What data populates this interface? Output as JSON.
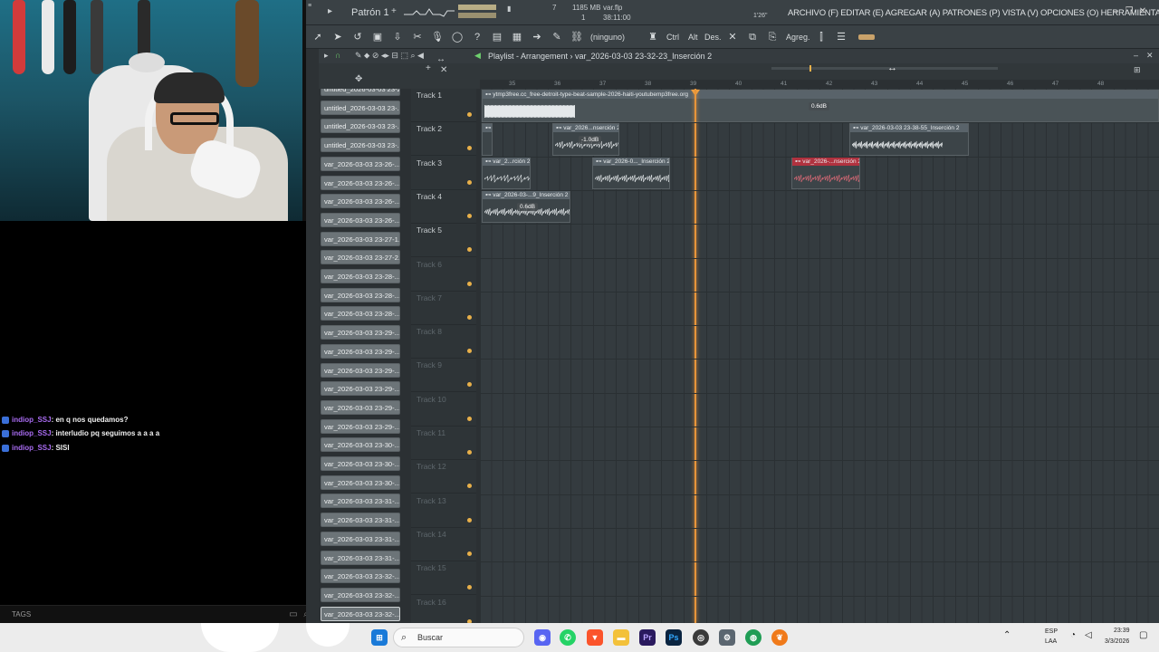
{
  "fl": {
    "pattern_label": "Patrón 1",
    "cpu_num": "7",
    "memory": "1185 MB",
    "mem_num": "1",
    "file_name": "var.flp",
    "time": "38:11:00",
    "zoom_time": "1'26\"",
    "menu": "ARCHIVO (F) EDITAR (E) AGREGAR (A) PATRONES (P) VISTA (V) OPCIONES (O) HERRAMIENTAS (T) AYUDA",
    "toolbar_none": "(ninguno)",
    "toolbar_ctrl": "Ctrl",
    "toolbar_alt": "Alt",
    "toolbar_des": "Des.",
    "toolbar_agreg": "Agreg.",
    "playlist_title": "Playlist - Arrangement",
    "arrangement_name": "var_2026-03-03 23-32-23_Inserción 2",
    "bar_numbers": [
      "35",
      "36",
      "37",
      "38",
      "39",
      "40",
      "41",
      "42",
      "43",
      "44",
      "45",
      "46",
      "47",
      "48"
    ],
    "patterns": [
      "untitled_2026-03-03 23-2",
      "untitled_2026-03-03 23-...",
      "untitled_2026-03-03 23-...",
      "untitled_2026-03-03 23-...",
      "var_2026-03-03 23-26-...",
      "var_2026-03-03 23-26-...",
      "var_2026-03-03 23-26-...",
      "var_2026-03-03 23-26-...",
      "var_2026-03-03 23-27-1...",
      "var_2026-03-03 23-27-2...",
      "var_2026-03-03 23-28-...",
      "var_2026-03-03 23-28-...",
      "var_2026-03-03 23-28-...",
      "var_2026-03-03 23-29-...",
      "var_2026-03-03 23-29-...",
      "var_2026-03-03 23-29-...",
      "var_2026-03-03 23-29-...",
      "var_2026-03-03 23-29-...",
      "var_2026-03-03 23-29-...",
      "var_2026-03-03 23-30-...",
      "var_2026-03-03 23-30-...",
      "var_2026-03-03 23-30-...",
      "var_2026-03-03 23-31-...",
      "var_2026-03-03 23-31-...",
      "var_2026-03-03 23-31-...",
      "var_2026-03-03 23-31-...",
      "var_2026-03-03 23-32-...",
      "var_2026-03-03 23-32-...",
      "var_2026-03-03 23-32-..."
    ],
    "tracks": [
      "Track 1",
      "Track 2",
      "Track 3",
      "Track 4",
      "Track 5",
      "Track 6",
      "Track 7",
      "Track 8",
      "Track 9",
      "Track 10",
      "Track 11",
      "Track 12",
      "Track 13",
      "Track 14",
      "Track 15",
      "Track 16"
    ],
    "clips": {
      "c1": {
        "title": "ytmp3free.cc_free-detroit-type-beat-sample-2026-haiti-youtubemp3free.org",
        "gain": "0.6dB"
      },
      "c2a": {
        "title": ""
      },
      "c2b": {
        "title": "var_2026...nserción 2",
        "gain": "-1.0dB"
      },
      "c2c": {
        "title": "var_2026-03-03 23-38-55_Inserción 2"
      },
      "c3a": {
        "title": "var_2...rción 2"
      },
      "c3b": {
        "title": "var_2026-0..._Inserción 2"
      },
      "c3c": {
        "title": "var_2026-...nserción 2"
      },
      "c4a": {
        "title": "var_2026-03-...9_Inserción 2",
        "gain": "0.6dB"
      }
    }
  },
  "chat": [
    {
      "user": "indiop_SSJ",
      "msg": ": en q nos quedamos?"
    },
    {
      "user": "indiop_SSJ",
      "msg": ": interludio pq seguimos a a a a"
    },
    {
      "user": "indiop_SSJ",
      "msg": ": SISI"
    }
  ],
  "tags_label": "TAGS",
  "taskbar": {
    "search_placeholder": "Buscar",
    "lang_top": "ESP",
    "lang_bottom": "LAA",
    "clock_time": "23:39",
    "clock_date": "3/3/2026"
  },
  "colors": {
    "playhead": "#e8953a",
    "chat_user": "#a96cf2",
    "red_clip": "#b0323f"
  }
}
